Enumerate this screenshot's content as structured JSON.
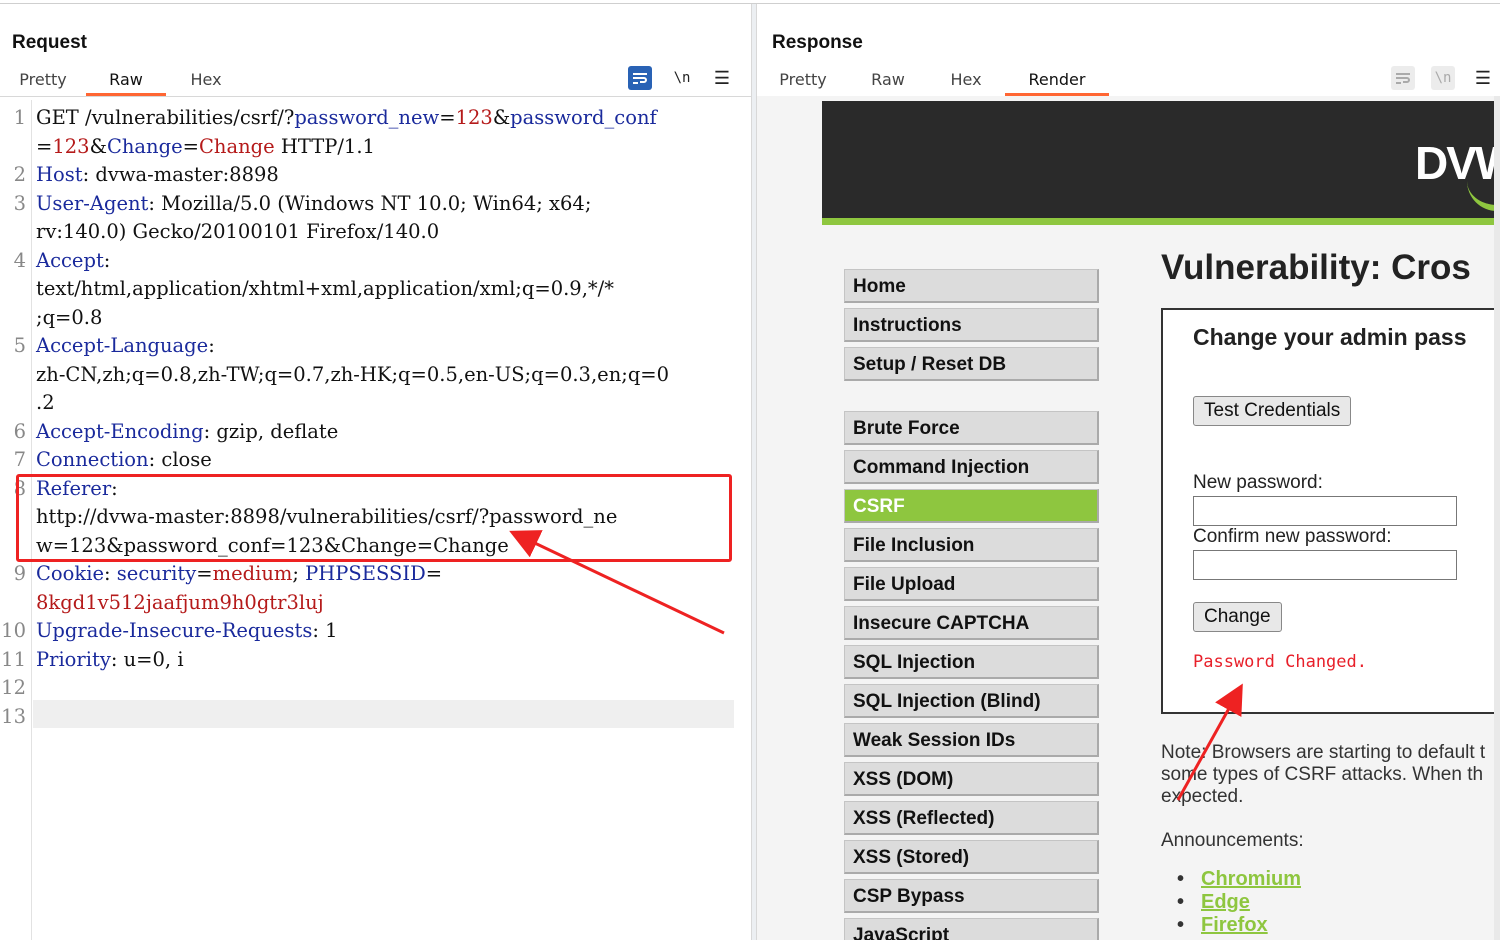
{
  "request": {
    "title": "Request",
    "tabs": [
      "Pretty",
      "Raw",
      "Hex"
    ],
    "active_tab": "Raw",
    "lines": [
      {
        "n": "1",
        "segments": [
          [
            "GET /vulnerabilities/csrf/?",
            "t"
          ],
          [
            "password_new",
            "k"
          ],
          [
            "=",
            "t"
          ],
          [
            "123",
            "v"
          ],
          [
            "&",
            "t"
          ],
          [
            "password_conf",
            "k"
          ]
        ]
      },
      {
        "n": "",
        "segments": [
          [
            "=",
            "t"
          ],
          [
            "123",
            "v"
          ],
          [
            "&",
            "t"
          ],
          [
            "Change",
            "k"
          ],
          [
            "=",
            "t"
          ],
          [
            "Change",
            "v"
          ],
          [
            " HTTP/1.1",
            "t"
          ]
        ]
      },
      {
        "n": "2",
        "segments": [
          [
            "Host",
            "k"
          ],
          [
            ": dvwa-master:8898",
            "t"
          ]
        ]
      },
      {
        "n": "3",
        "segments": [
          [
            "User-Agent",
            "k"
          ],
          [
            ": Mozilla/5.0 (Windows NT 10.0; Win64; x64;",
            "t"
          ]
        ]
      },
      {
        "n": "",
        "segments": [
          [
            "rv:140.0) Gecko/20100101 Firefox/140.0",
            "t"
          ]
        ]
      },
      {
        "n": "4",
        "segments": [
          [
            "Accept",
            "k"
          ],
          [
            ":",
            "t"
          ]
        ]
      },
      {
        "n": "",
        "segments": [
          [
            "text/html,application/xhtml+xml,application/xml;q=0.9,*/*",
            "t"
          ]
        ]
      },
      {
        "n": "",
        "segments": [
          [
            ";q=0.8",
            "t"
          ]
        ]
      },
      {
        "n": "5",
        "segments": [
          [
            "Accept-Language",
            "k"
          ],
          [
            ":",
            "t"
          ]
        ]
      },
      {
        "n": "",
        "segments": [
          [
            "zh-CN,zh;q=0.8,zh-TW;q=0.7,zh-HK;q=0.5,en-US;q=0.3,en;q=0",
            "t"
          ]
        ]
      },
      {
        "n": "",
        "segments": [
          [
            ".2",
            "t"
          ]
        ]
      },
      {
        "n": "6",
        "segments": [
          [
            "Accept-Encoding",
            "k"
          ],
          [
            ": gzip, deflate",
            "t"
          ]
        ]
      },
      {
        "n": "7",
        "segments": [
          [
            "Connection",
            "k"
          ],
          [
            ": close",
            "t"
          ]
        ]
      },
      {
        "n": "8",
        "segments": [
          [
            "Referer",
            "k"
          ],
          [
            ":",
            "t"
          ]
        ]
      },
      {
        "n": "",
        "segments": [
          [
            "http://dvwa-master:8898/vulnerabilities/csrf/?password_ne",
            "t"
          ]
        ]
      },
      {
        "n": "",
        "segments": [
          [
            "w=123&password_conf=123&Change=Change",
            "t"
          ]
        ]
      },
      {
        "n": "9",
        "segments": [
          [
            "Cookie",
            "k"
          ],
          [
            ": ",
            "t"
          ],
          [
            "security",
            "k"
          ],
          [
            "=",
            "t"
          ],
          [
            "medium",
            "v"
          ],
          [
            "; ",
            "t"
          ],
          [
            "PHPSESSID",
            "k"
          ],
          [
            "=",
            "t"
          ]
        ]
      },
      {
        "n": "",
        "segments": [
          [
            "8kgd1v512jaafjum9h0gtr3luj",
            "v"
          ]
        ]
      },
      {
        "n": "10",
        "segments": [
          [
            "Upgrade-Insecure-Requests",
            "k"
          ],
          [
            ": 1",
            "t"
          ]
        ]
      },
      {
        "n": "11",
        "segments": [
          [
            "Priority",
            "k"
          ],
          [
            ": u=0, i",
            "t"
          ]
        ]
      },
      {
        "n": "12",
        "segments": []
      },
      {
        "n": "13",
        "segments": []
      }
    ]
  },
  "response": {
    "title": "Response",
    "tabs": [
      "Pretty",
      "Raw",
      "Hex",
      "Render"
    ],
    "active_tab": "Render",
    "page": {
      "logo_text": "DVW",
      "menu_group1": [
        "Home",
        "Instructions",
        "Setup / Reset DB"
      ],
      "menu_group2": [
        "Brute Force",
        "Command Injection",
        "CSRF",
        "File Inclusion",
        "File Upload",
        "Insecure CAPTCHA",
        "SQL Injection",
        "SQL Injection (Blind)",
        "Weak Session IDs",
        "XSS (DOM)",
        "XSS (Reflected)",
        "XSS (Stored)",
        "CSP Bypass",
        "JavaScript"
      ],
      "active_menu": "CSRF",
      "heading": "Vulnerability: Cros",
      "box_heading": "Change your admin pass",
      "test_button": "Test Credentials",
      "new_password_label": "New password:",
      "confirm_password_label": "Confirm new password:",
      "change_button": "Change",
      "status_message": "Password Changed.",
      "note_lines": [
        "Note: Browsers are starting to default t",
        "some types of CSRF attacks. When th",
        "expected."
      ],
      "announcements_label": "Announcements:",
      "announcement_links": [
        "Chromium",
        "Edge",
        "Firefox"
      ]
    }
  },
  "colors": {
    "accent_tab": "#ff6633",
    "header_key": "#1a2a9c",
    "header_value": "#b51a1a",
    "dvwa_green": "#8ec63f",
    "annotation_red": "#ee2222"
  },
  "icons": {
    "wrap": "word-wrap-icon",
    "newline": "newline-icon",
    "menu": "hamburger-icon"
  }
}
